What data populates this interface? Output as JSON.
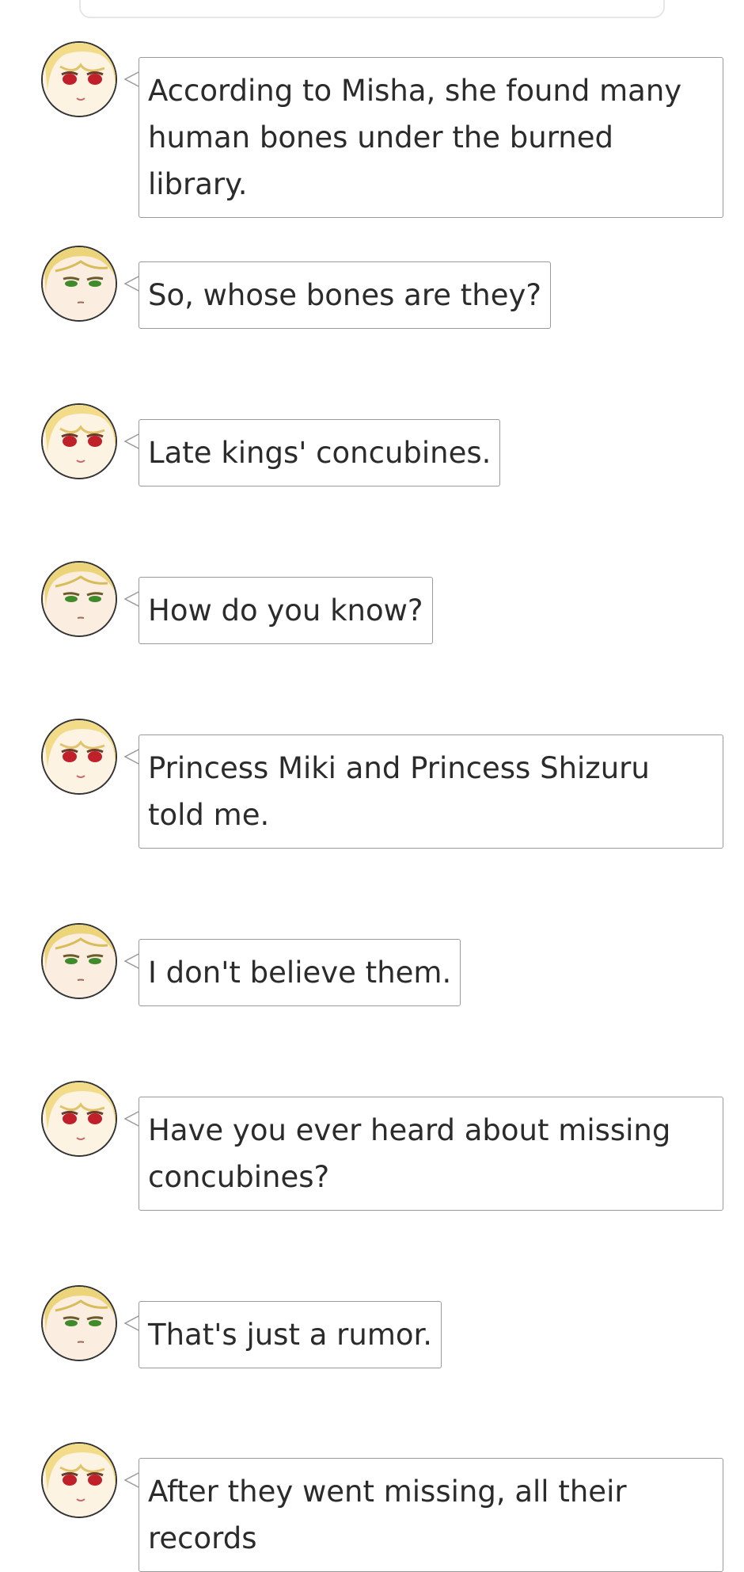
{
  "speakers": {
    "girl": {
      "name": "girl-avatar",
      "eye_color": "#c0202a",
      "hair_color": "#f2dc8a"
    },
    "boy": {
      "name": "boy-avatar",
      "eye_color": "#3f8a2a",
      "hair_color": "#ecd47a",
      "collar_color": "#2e5fa6"
    }
  },
  "messages": [
    {
      "speaker": "girl",
      "text": "According to Misha, she found many human bones under the burned library."
    },
    {
      "speaker": "boy",
      "text": "So, whose bones are they?"
    },
    {
      "speaker": "girl",
      "text": "Late kings' concubines."
    },
    {
      "speaker": "boy",
      "text": "How do you know?"
    },
    {
      "speaker": "girl",
      "text": "Princess Miki and Princess Shizuru told me."
    },
    {
      "speaker": "boy",
      "text": "I don't believe them."
    },
    {
      "speaker": "girl",
      "text": "Have you ever heard about missing concubines?"
    },
    {
      "speaker": "boy",
      "text": "That's just a rumor."
    },
    {
      "speaker": "girl",
      "text": "After they went missing, all their records"
    }
  ]
}
